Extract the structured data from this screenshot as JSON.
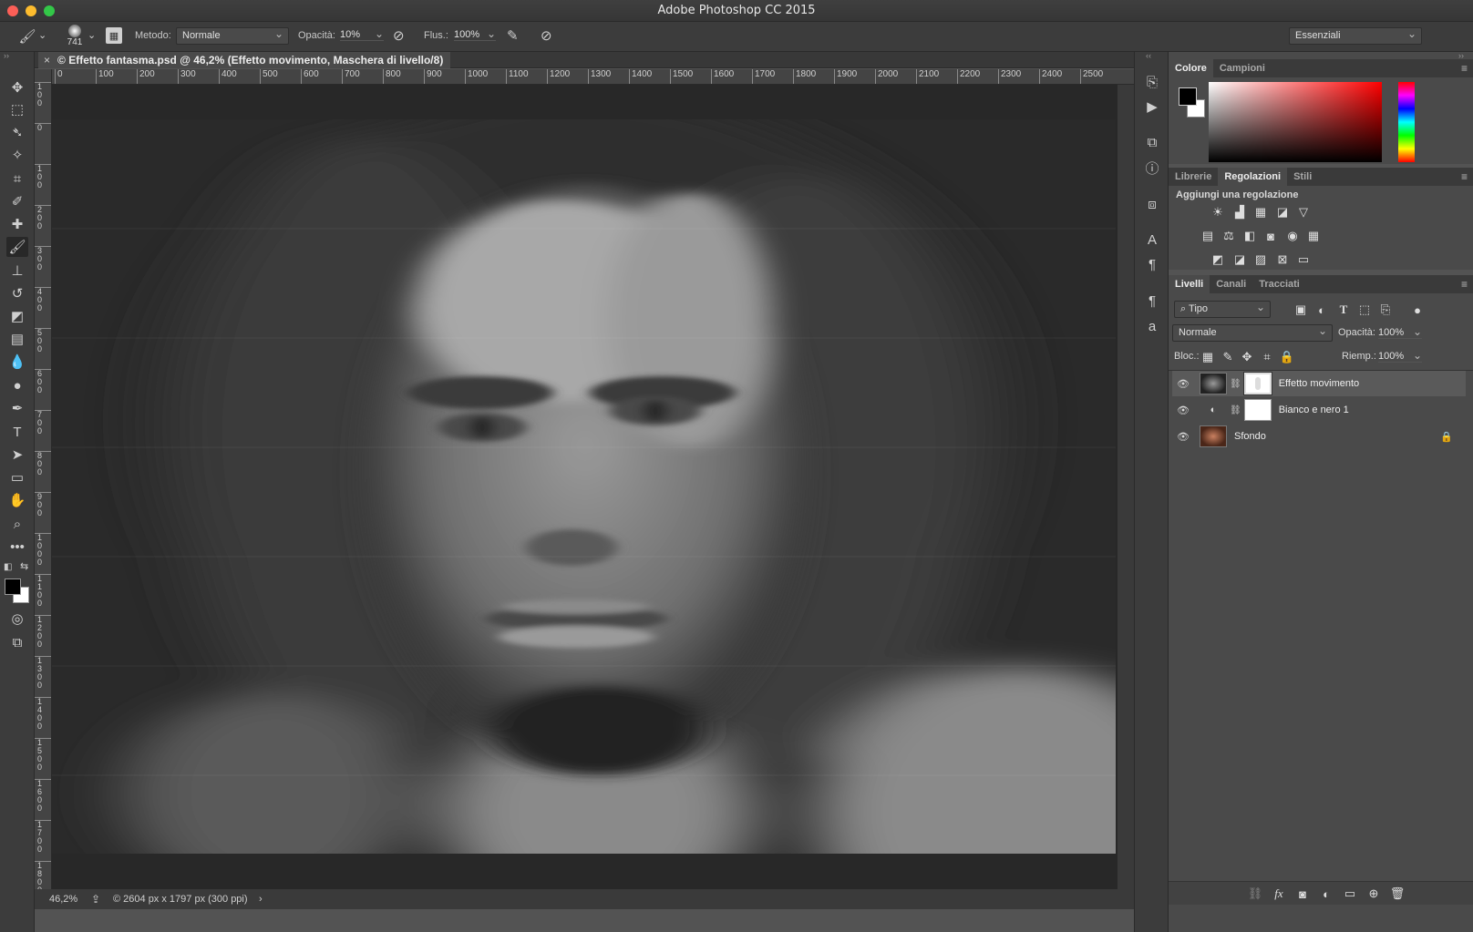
{
  "window": {
    "title": "Adobe Photoshop CC 2015"
  },
  "options_bar": {
    "brush_size": "741",
    "method_label": "Metodo:",
    "method_value": "Normale",
    "opacity_label": "Opacità:",
    "opacity_value": "10%",
    "flow_label": "Flus.:",
    "flow_value": "100%",
    "workspace_value": "Essenziali"
  },
  "document": {
    "tab_label": "© Effetto fantasma.psd @ 46,2% (Effetto movimento, Maschera di livello/8)",
    "zoom": "46,2%",
    "info": "© 2604 px x 1797 px (300 ppi)"
  },
  "ruler": {
    "top": [
      "0",
      "100",
      "200",
      "300",
      "400",
      "500",
      "600",
      "700",
      "800",
      "900",
      "1000",
      "1100",
      "1200",
      "1300",
      "1400",
      "1500",
      "1600",
      "1700",
      "1800",
      "1900",
      "2000",
      "2100",
      "2200",
      "2300",
      "2400",
      "2500"
    ],
    "left": [
      "100",
      "0",
      "100",
      "200",
      "300",
      "400",
      "500",
      "600",
      "700",
      "800",
      "900",
      "1000",
      "1100",
      "1200",
      "1300",
      "1400",
      "1500",
      "1600",
      "1700",
      "1800"
    ]
  },
  "color_panel": {
    "tabs": [
      "Colore",
      "Campioni"
    ],
    "foreground": "#000000",
    "background": "#ffffff",
    "hue": "#ff0000"
  },
  "adjust_panel": {
    "tabs": [
      "Librerie",
      "Regolazioni",
      "Stili"
    ],
    "heading": "Aggiungi una regolazione"
  },
  "layers_panel": {
    "tabs": [
      "Livelli",
      "Canali",
      "Tracciati"
    ],
    "filter_value": "Tipo",
    "blend_mode": "Normale",
    "opacity_label": "Opacità:",
    "opacity_value": "100%",
    "lock_label": "Bloc.:",
    "fill_label": "Riemp.:",
    "fill_value": "100%",
    "layers": [
      {
        "name": "Effetto movimento",
        "selected": true
      },
      {
        "name": "Bianco e nero 1",
        "selected": false
      },
      {
        "name": "Sfondo",
        "selected": false
      }
    ]
  }
}
